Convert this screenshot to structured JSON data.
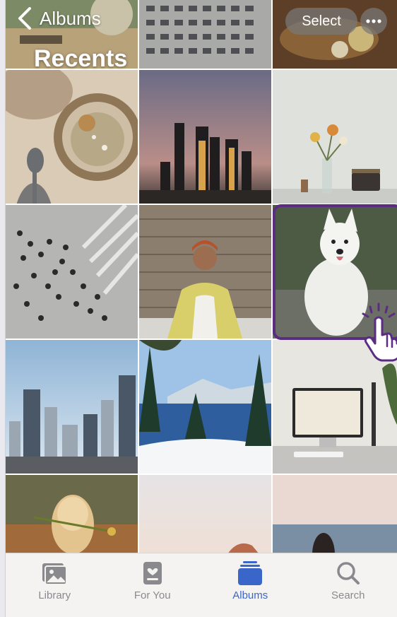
{
  "nav": {
    "back_label": "Albums",
    "title": "Recents",
    "select_label": "Select",
    "more_icon": "ellipsis-icon"
  },
  "tabs": [
    {
      "label": "Library",
      "icon": "library-icon",
      "active": false
    },
    {
      "label": "For You",
      "icon": "for-you-icon",
      "active": false
    },
    {
      "label": "Albums",
      "icon": "albums-icon",
      "active": true
    },
    {
      "label": "Search",
      "icon": "search-icon",
      "active": false
    }
  ],
  "colors": {
    "accent": "#3a66c9",
    "highlight": "#5a2c82",
    "tab_inactive": "#8a8a8e"
  }
}
